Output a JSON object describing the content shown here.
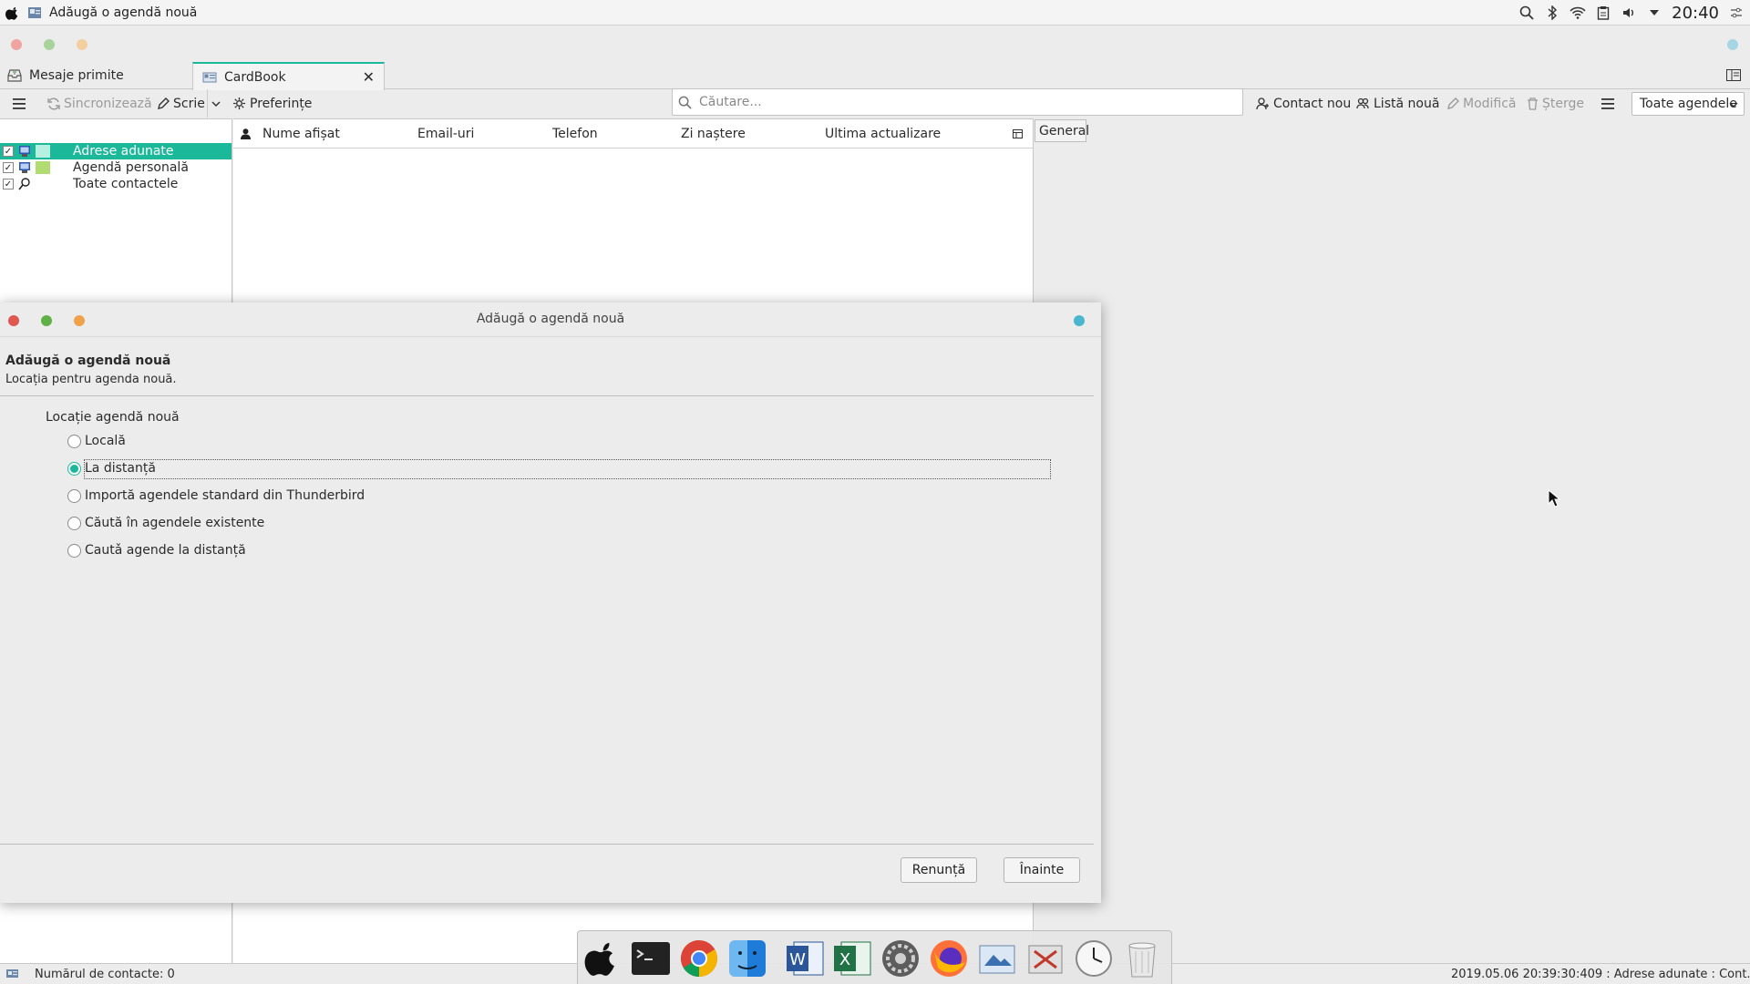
{
  "menubar": {
    "window_title": "Adăugă o agendă nouă",
    "clock": "20:40",
    "icons": [
      "apple-icon",
      "search-icon",
      "bluetooth-icon",
      "wifi-icon",
      "clipboard-icon",
      "volume-icon",
      "caret-down-icon",
      "settings-icon"
    ]
  },
  "tabs": [
    {
      "label": "Mesaje primite",
      "icon": "inbox-icon"
    },
    {
      "label": "CardBook",
      "icon": "address-book-icon"
    }
  ],
  "toolbar": {
    "sync": "Sincronizează",
    "write": "Scrie",
    "preferences": "Preferințe",
    "search_placeholder": "Căutare...",
    "new_contact": "Contact nou",
    "new_list": "Listă nouă",
    "edit": "Modifică",
    "delete": "Șterge",
    "books_select": "Toate agendele"
  },
  "tree": {
    "items": [
      {
        "label": "Adrese adunate",
        "selected": true,
        "color": "#b6f0e0"
      },
      {
        "label": "Agendă personală",
        "selected": false,
        "color": "#b0dc72"
      },
      {
        "label": "Toate contactele",
        "selected": false,
        "color": ""
      }
    ]
  },
  "list": {
    "columns": [
      "Nume afișat",
      "Email-uri",
      "Telefon",
      "Zi naștere",
      "Ultima actualizare"
    ]
  },
  "details_tab": "General",
  "status": {
    "count": "Numărul de contacte: 0",
    "log": "2019.05.06 20:39:30:409 : Adrese adunate : Cont..."
  },
  "dialog": {
    "title": "Adăugă o agendă nouă",
    "heading": "Adăugă o agendă nouă",
    "subheading": "Locația pentru agenda nouă.",
    "group_label": "Locație agendă nouă",
    "options": [
      {
        "label": "Locală",
        "checked": false
      },
      {
        "label": "La distanță",
        "checked": true
      },
      {
        "label": "Importă agendele standard din Thunderbird",
        "checked": false
      },
      {
        "label": "Căută în agendele existente",
        "checked": false
      },
      {
        "label": "Cautǎ agende la distanță",
        "checked": false
      }
    ],
    "cancel": "Renunță",
    "next": "Înainte"
  },
  "colors": {
    "accent": "#1bb99a",
    "close_dot": "#e0574f",
    "minimize_dot": "#5fb048",
    "maximize_dot": "#f0a24a",
    "info_dot": "#4ab7d0"
  },
  "dock": {
    "apps": [
      "apple-icon",
      "terminal-icon",
      "chrome-icon",
      "finder-icon",
      "word-icon",
      "excel-icon",
      "system-settings-icon",
      "firefox-icon",
      "mail-icon",
      "utilities-icon",
      "clock-icon",
      "trash-icon"
    ]
  }
}
